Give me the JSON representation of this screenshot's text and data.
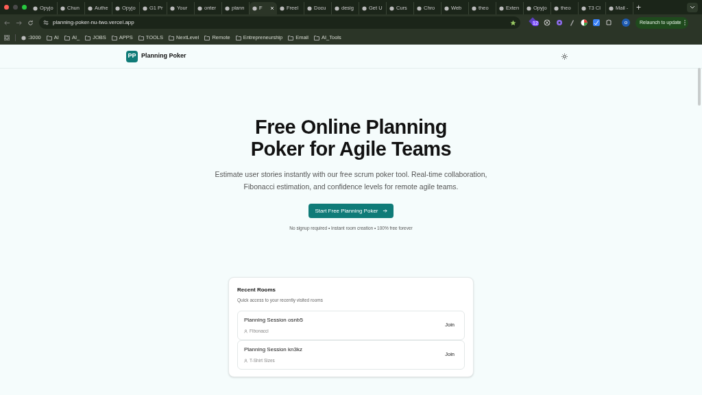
{
  "browser": {
    "tabs": [
      {
        "title": "Opyjo",
        "selected": false
      },
      {
        "title": "Chun",
        "selected": false
      },
      {
        "title": "Authe",
        "selected": false
      },
      {
        "title": "Opyjo",
        "selected": false
      },
      {
        "title": "G1 Pr",
        "selected": false
      },
      {
        "title": "Your",
        "selected": false
      },
      {
        "title": "onter",
        "selected": false
      },
      {
        "title": "plann",
        "selected": false
      },
      {
        "title": "F",
        "selected": true
      },
      {
        "title": "Freel",
        "selected": false
      },
      {
        "title": "Docu",
        "selected": false
      },
      {
        "title": "desig",
        "selected": false
      },
      {
        "title": "Get U",
        "selected": false
      },
      {
        "title": "Curs",
        "selected": false
      },
      {
        "title": "Chro",
        "selected": false
      },
      {
        "title": "Web",
        "selected": false
      },
      {
        "title": "theo",
        "selected": false
      },
      {
        "title": "Exten",
        "selected": false
      },
      {
        "title": "Opyjo",
        "selected": false
      },
      {
        "title": "theo",
        "selected": false
      },
      {
        "title": "T3 Cl",
        "selected": false
      },
      {
        "title": "Mail -",
        "selected": false
      }
    ],
    "new_tab": "+",
    "address": "planning-poker-nu-two.vercel.app",
    "extension_badge": "12",
    "profile": "o",
    "relaunch": "Relaunch to update",
    "bookmarks": [
      {
        "label": ":3000",
        "kind": "site"
      },
      {
        "label": "AI",
        "kind": "folder"
      },
      {
        "label": "AI_",
        "kind": "folder"
      },
      {
        "label": "JOBS",
        "kind": "folder"
      },
      {
        "label": "APPS",
        "kind": "folder"
      },
      {
        "label": "TOOLS",
        "kind": "folder"
      },
      {
        "label": "NextLevel",
        "kind": "folder"
      },
      {
        "label": "Remote",
        "kind": "folder"
      },
      {
        "label": "Entrepreneurship",
        "kind": "folder"
      },
      {
        "label": "Email",
        "kind": "folder"
      },
      {
        "label": "AI_Tools",
        "kind": "folder"
      }
    ]
  },
  "header": {
    "logo": "PP",
    "brand": "Planning Poker"
  },
  "hero": {
    "title_lines": [
      "Free Online Planning",
      "Poker for Agile Teams"
    ],
    "subtitle_lines": [
      "Estimate user stories instantly with our free scrum poker tool. Real-time collaboration,",
      "Fibonacci estimation, and confidence levels for remote agile teams."
    ],
    "cta": "Start Free Planning Poker",
    "note": "No signup required • Instant room creation • 100% free forever"
  },
  "recent_rooms": {
    "title": "Recent Rooms",
    "subtitle": "Quick access to your recently visited rooms",
    "rooms": [
      {
        "name": "Planning Session osnb5",
        "deck": "Fibonacci",
        "action": "Join"
      },
      {
        "name": "Planning Session kn3kz",
        "deck": "T-Shirt Sizes",
        "action": "Join"
      }
    ]
  }
}
